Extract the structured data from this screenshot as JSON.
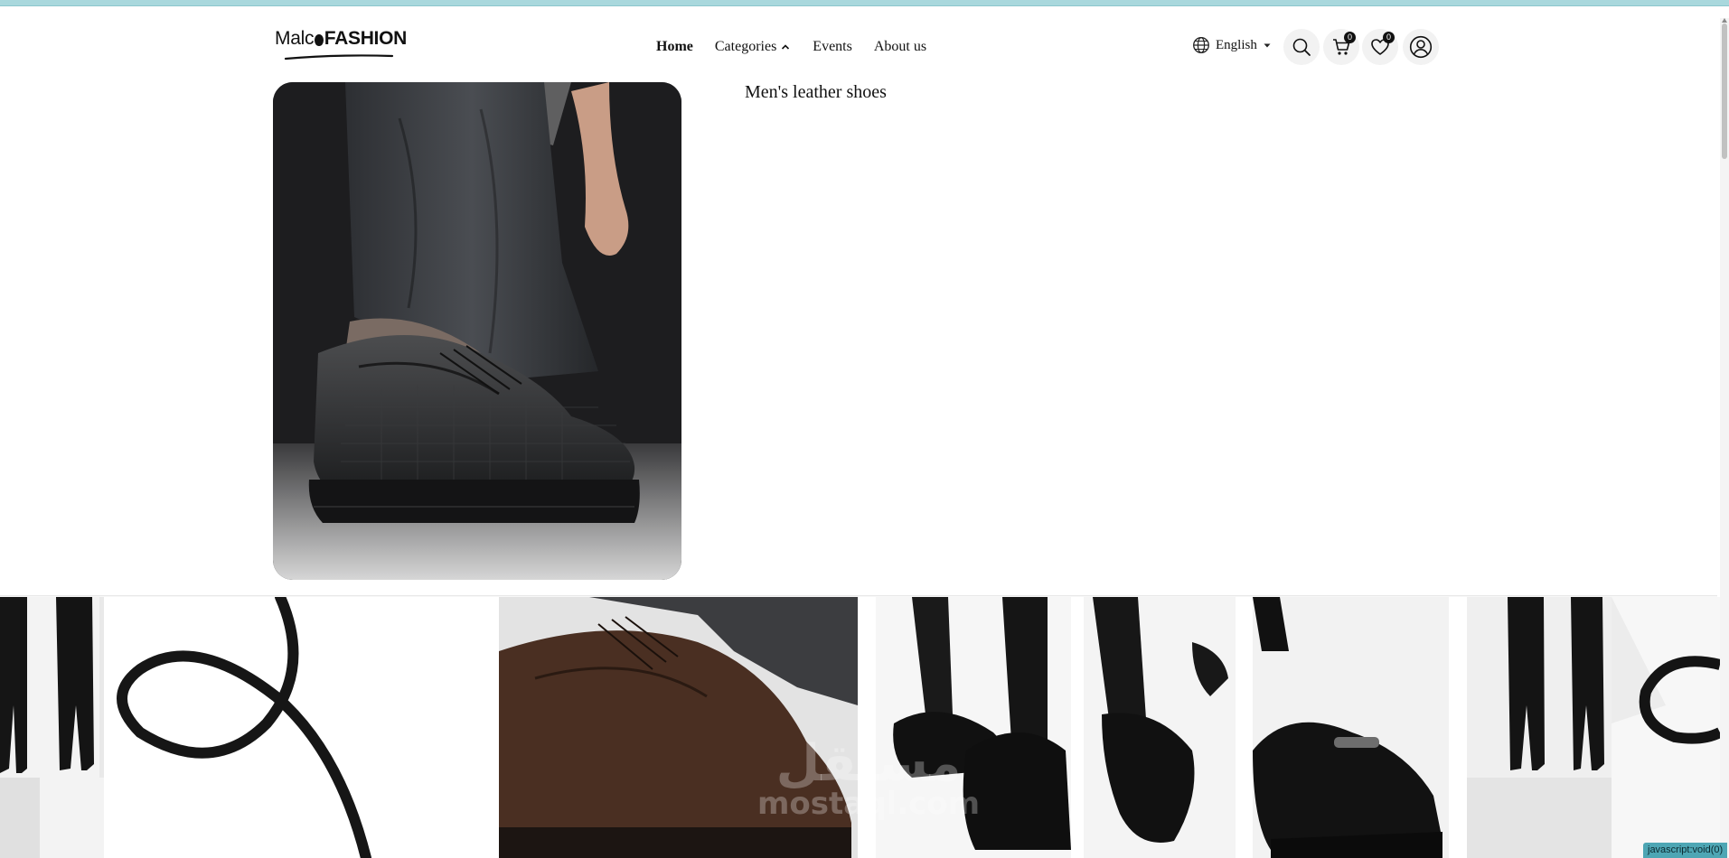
{
  "brand": {
    "logo_text_light": "Malc",
    "logo_text_bold": "FASHION"
  },
  "nav": {
    "home": "Home",
    "categories": "Categories",
    "events": "Events",
    "about": "About us"
  },
  "language": {
    "label": "English"
  },
  "cart": {
    "count": "0"
  },
  "wishlist": {
    "count": "0"
  },
  "product": {
    "title": "Men's leather shoes"
  },
  "watermark": {
    "arabic": "مستقل",
    "latin": "mostaql.com"
  },
  "status_bar": {
    "link": "javascript:void(0)"
  },
  "icons": {
    "globe": "globe-icon",
    "search": "search-icon",
    "cart": "cart-icon",
    "heart": "heart-icon",
    "user": "user-icon"
  }
}
